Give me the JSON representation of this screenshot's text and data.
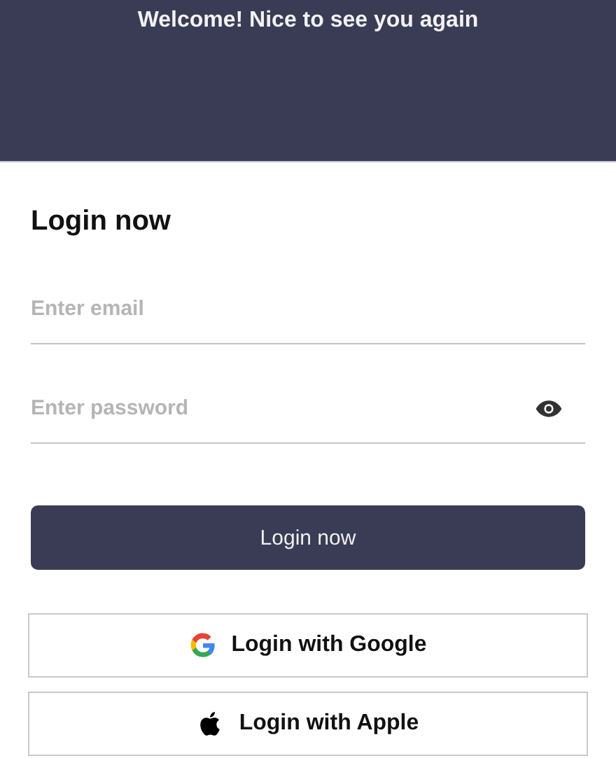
{
  "header": {
    "title": "Welcome! Nice to see you again"
  },
  "form": {
    "heading": "Login now",
    "fields": [
      {
        "kind": "email",
        "placeholder": "Enter email"
      },
      {
        "kind": "password",
        "placeholder": "Enter password"
      }
    ],
    "submit": "Login now",
    "providers": [
      {
        "kind": "google",
        "label": "Login with Google"
      },
      {
        "kind": "apple",
        "label": "Login with Apple"
      }
    ]
  }
}
